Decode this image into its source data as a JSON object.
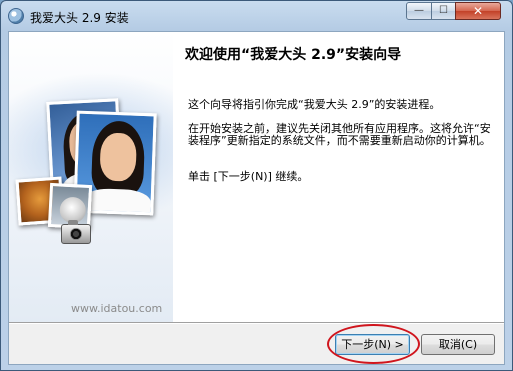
{
  "window": {
    "title": "我爱大头 2.9 安装",
    "controls": {
      "minimize": "—",
      "maximize": "☐",
      "close": "✕"
    }
  },
  "banner": {
    "website": "www.idatou.com"
  },
  "content": {
    "heading": "欢迎使用“我爱大头 2.9”安装向导",
    "paragraphs": [
      "这个向导将指引你完成“我爱大头 2.9”的安装进程。",
      "在开始安装之前，建议先关闭其他所有应用程序。这将允许“安装程序”更新指定的系统文件，而不需要重新启动你的计算机。",
      "单击 [下一步(N)] 继续。"
    ]
  },
  "buttons": {
    "next": "下一步(N) >",
    "cancel": "取消(C)"
  },
  "colors": {
    "highlight_ring": "#d0151d",
    "close_button": "#c24128"
  }
}
